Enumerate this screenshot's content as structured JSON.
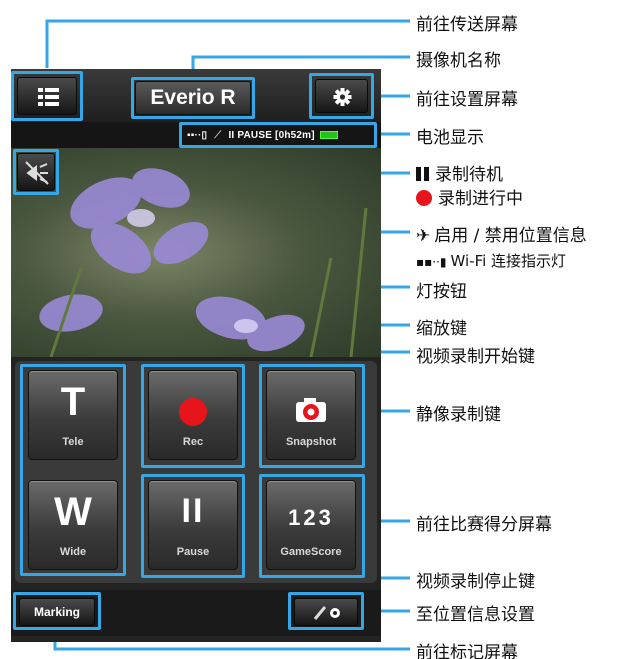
{
  "camera": {
    "name": "Everio R",
    "status_text": "II PAUSE [0h52m]",
    "status_icons": [
      "wifi-link-icon",
      "location-icon"
    ],
    "battery_color": "#27c01e"
  },
  "keys": {
    "tele": {
      "symbol": "T",
      "label": "Tele"
    },
    "wide": {
      "symbol": "W",
      "label": "Wide"
    },
    "rec": {
      "label": "Rec"
    },
    "pause": {
      "symbol": "II",
      "label": "Pause"
    },
    "snapshot": {
      "label": "Snapshot"
    },
    "gamescore": {
      "symbol": "123",
      "label": "GameScore"
    }
  },
  "bottom": {
    "marking_label": "Marking"
  },
  "colors": {
    "highlight": "#35a6e6",
    "rec_red": "#e8141c"
  },
  "callouts": {
    "transfer": "前往传送屏幕",
    "camera_name": "摄像机名称",
    "settings": "前往设置屏幕",
    "battery": "电池显示",
    "rec_standby": "录制待机",
    "rec_in_progress": "录制进行中",
    "location_toggle": "启用 / 禁用位置信息",
    "wifi_lamp": "Wi-Fi 连接指示灯",
    "light_button": "灯按钮",
    "zoom_key": "缩放键",
    "video_start": "视频录制开始键",
    "still_key": "静像录制键",
    "gamescore": "前往比赛得分屏幕",
    "video_stop": "视频录制停止键",
    "location_settings": "至位置信息设置",
    "marking": "前往标记屏幕"
  }
}
